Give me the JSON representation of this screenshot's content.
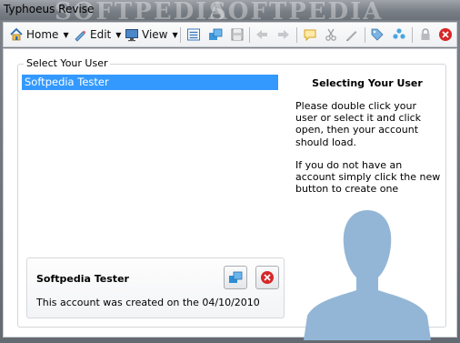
{
  "window": {
    "title": "Typhoeus Revise",
    "watermark_left": "SOFTPEDIA",
    "watermark_right": "SOFTPEDIA"
  },
  "toolbar": {
    "home_label": "Home",
    "edit_label": "Edit",
    "view_label": "View",
    "icons": [
      "list-icon",
      "open-icon",
      "save-icon",
      "back-icon",
      "forward-icon",
      "comment-icon",
      "cut-icon",
      "pen-icon",
      "tag-icon",
      "group-icon",
      "lock-icon",
      "close-icon"
    ]
  },
  "select_user": {
    "group_label": "Select Your User",
    "users": [
      {
        "name": "Softpedia Tester",
        "selected": true
      }
    ]
  },
  "info_panel": {
    "title": "Selecting Your User",
    "text_1": "Please double click your user or select it and click open, then your account should load.",
    "text_2": "If you do not have an account simply click the new button to create one"
  },
  "detail_card": {
    "name": "Softpedia Tester",
    "created_text": "This account was created on the 04/10/2010"
  },
  "colors": {
    "selection": "#3399ff",
    "silhouette": "#94b6d6",
    "delete_red": "#d62828",
    "open_blue": "#2d8fd6"
  }
}
